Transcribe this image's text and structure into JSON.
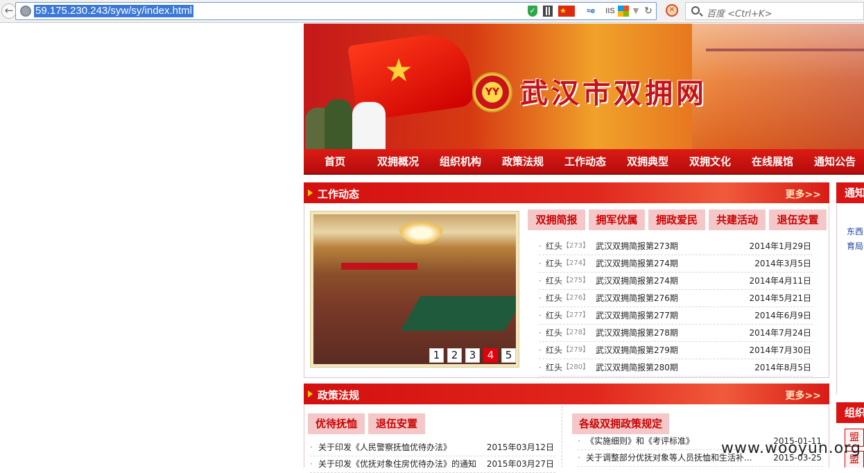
{
  "browser": {
    "url": "59.175.230.243/syw/sy/index.html",
    "search_placeholder": "百度 <Ctrl+K>",
    "icons": [
      "back-icon",
      "globe-icon",
      "shield-icon",
      "qr-code-icon",
      "china-flag-icon",
      "ie-icon",
      "iis-icon",
      "windows-icon",
      "dropdown-icon",
      "reload-icon",
      "extension-icon",
      "search-icon"
    ],
    "ie_label": "≈e",
    "iis_label": "IIS"
  },
  "site": {
    "title": "武汉市双拥网",
    "emblem_text": "YY"
  },
  "nav": [
    "首页",
    "双拥概况",
    "组织机构",
    "政策法规",
    "工作动态",
    "双拥典型",
    "双拥文化",
    "在线展馆",
    "通知公告"
  ],
  "work_news": {
    "title": "工作动态",
    "more": "更多>>",
    "tabs": [
      "双拥简报",
      "拥军优属",
      "拥政爱民",
      "共建活动",
      "退伍安置"
    ],
    "pager": [
      "1",
      "2",
      "3",
      "4",
      "5"
    ],
    "active_page": 4,
    "items": [
      {
        "src": "红头",
        "num": "【273】",
        "title": "武汉双拥简报第273期",
        "date": "2014年1月29日"
      },
      {
        "src": "红头",
        "num": "【274】",
        "title": "武汉双拥简报第274期",
        "date": "2014年3月5日"
      },
      {
        "src": "红头",
        "num": "【275】",
        "title": "武汉双拥简报第274期",
        "date": "2014年4月11日"
      },
      {
        "src": "红头",
        "num": "【276】",
        "title": "武汉双拥简报第276期",
        "date": "2014年5月21日"
      },
      {
        "src": "红头",
        "num": "【277】",
        "title": "武汉双拥简报第277期",
        "date": "2014年6月9日"
      },
      {
        "src": "红头",
        "num": "【278】",
        "title": "武汉双拥简报第278期",
        "date": "2014年7月24日"
      },
      {
        "src": "红头",
        "num": "【279】",
        "title": "武汉双拥简报第279期",
        "date": "2014年7月30日"
      },
      {
        "src": "红头",
        "num": "【280】",
        "title": "武汉双拥简报第280期",
        "date": "2014年8月5日"
      }
    ]
  },
  "policy": {
    "title": "政策法规",
    "more": "更多>>",
    "left_tabs": [
      "优待抚恤",
      "退伍安置"
    ],
    "right_tab": "各级双拥政策规定",
    "left_items": [
      {
        "title": "关于印发《人民警察抚恤优待办法》",
        "date": "2015年03月12日"
      },
      {
        "title": "关于印发《优抚对象住房优待办法》的通知",
        "date": "2015年03月27日"
      }
    ],
    "right_items": [
      {
        "title": "《实施细则》和《考评标准》",
        "date": "2015-01-11"
      },
      {
        "title": "关于调整部分优抚对象等人员抚恤和生活补...",
        "date": "2015-03-25"
      }
    ]
  },
  "right_column": {
    "head1": "通知",
    "links": [
      "东西",
      "育局"
    ],
    "head2": "组织",
    "stamps": [
      "盟",
      "盟"
    ]
  },
  "watermark": "www.wooyun.org"
}
